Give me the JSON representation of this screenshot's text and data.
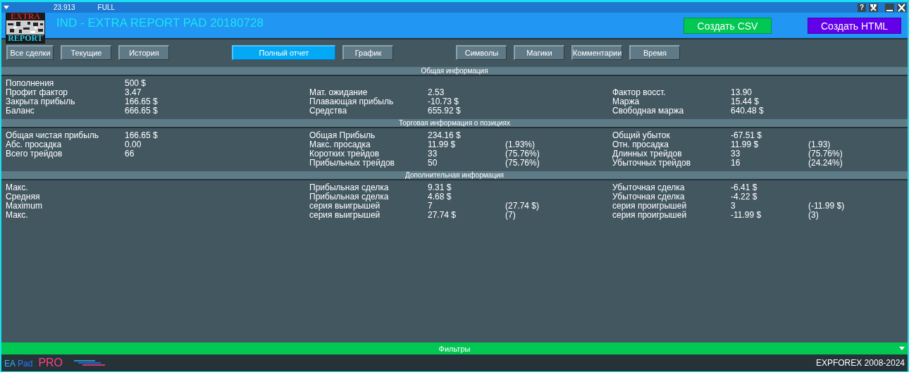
{
  "top_bar": {
    "version": "23.913",
    "mode": "FULL",
    "help": "?"
  },
  "header": {
    "logo": {
      "top": "EXTRA",
      "bottom": "REPORT"
    },
    "title": "IND - EXTRA REPORT PAD 20180728",
    "buttons": [
      {
        "label": "Создать CSV",
        "color": "#00c853"
      },
      {
        "label": "Создать HTML",
        "color": "#6200ea"
      }
    ]
  },
  "tab_groups": [
    [
      {
        "label": "Все сделки",
        "selected": false
      },
      {
        "label": "Текущие",
        "selected": false
      },
      {
        "label": "История",
        "selected": false
      }
    ],
    [
      {
        "label": "Полный отчет",
        "selected": true
      },
      {
        "label": "График",
        "selected": false
      }
    ],
    [
      {
        "label": "Символы",
        "selected": false
      },
      {
        "label": "Магики",
        "selected": false
      },
      {
        "label": "Комментарии",
        "selected": false
      },
      {
        "label": "Время",
        "selected": false
      }
    ]
  ],
  "sections": [
    {
      "title": "Общая информация",
      "rows": [
        {
          "left": {
            "label": "Пополнения",
            "value": "500 $"
          }
        },
        {
          "left": {
            "label": "Профит фактор",
            "value": "3.47"
          },
          "middle": {
            "label": "Мат. ожидание",
            "value": "2.53"
          },
          "right": {
            "label": "Фактор восст.",
            "value": "13.90"
          }
        },
        {
          "left": {
            "label": "Закрыта прибыль",
            "value": "166.65 $"
          },
          "middle": {
            "label": "Плавающая прибыль",
            "value": "-10.73 $"
          },
          "right": {
            "label": "Маржа",
            "value": "15.44 $"
          }
        },
        {
          "left": {
            "label": "Баланс",
            "value": "666.65 $"
          },
          "middle": {
            "label": "Средства",
            "value": "655.92 $"
          },
          "right": {
            "label": "Свободная маржа",
            "value": "640.48 $"
          }
        }
      ]
    },
    {
      "title": "Торговая информация о позициях",
      "rows": [
        {
          "left": {
            "label": "Общая чистая прибыль",
            "value": "166.65 $"
          },
          "middle": {
            "label": "Общая Прибыль",
            "value": "234.16 $"
          },
          "right": {
            "label": "Общий убыток",
            "value": "-67.51 $"
          }
        },
        {
          "left": {
            "label": "Абс. просадка",
            "value": "0.00"
          },
          "middle": {
            "label": "Макс. просадка",
            "value": "11.99 $",
            "note": "(1.93%)"
          },
          "right": {
            "label": "Отн. просадка",
            "value": "11.99 $",
            "note": "(1.93)"
          }
        },
        {
          "left": {
            "label": "Всего трейдов",
            "value": "66"
          },
          "middle": {
            "label": "Коротких трейдов",
            "value": "33",
            "note": "(75.76%)"
          },
          "right": {
            "label": "Длинных трейдов",
            "value": "33",
            "note": "(75.76%)"
          }
        },
        {
          "middle": {
            "label": "Прибыльных трейдов",
            "value": "50",
            "note": "(75.76%)"
          },
          "right": {
            "label": "Убыточных трейдов",
            "value": "16",
            "note": "(24.24%)"
          }
        }
      ]
    },
    {
      "title": "Дополнительная информация",
      "rows": [
        {
          "left": {
            "label": "Макс."
          },
          "middle": {
            "label": "Прибыльная сделка",
            "value": "9.31 $"
          },
          "right": {
            "label": "Убыточная сделка",
            "value": "-6.41 $"
          }
        },
        {
          "left": {
            "label": "Средняя"
          },
          "middle": {
            "label": "Прибыльная сделка",
            "value": "4.68 $"
          },
          "right": {
            "label": "Убыточная сделка",
            "value": "-4.22 $"
          }
        },
        {
          "left": {
            "label": "Maximum"
          },
          "middle": {
            "label": "серия выигрышей",
            "value": "7",
            "note": "(27.74 $)"
          },
          "right": {
            "label": "серия проигрышей",
            "value": "3",
            "note": "(-11.99 $)"
          }
        },
        {
          "left": {
            "label": "Макс."
          },
          "middle": {
            "label": "серия выигрышей",
            "value": "27.74 $",
            "note": "(7)"
          },
          "right": {
            "label": "серия проигрышей",
            "value": "-11.99 $",
            "note": "(3)"
          }
        }
      ]
    }
  ],
  "filter_bar": {
    "label": "Фильтры"
  },
  "footer": {
    "brand": [
      {
        "text": "EA",
        "color": "#29b6f6"
      },
      {
        "text": "Pad",
        "color": "#2979ff"
      },
      {
        "text": "PRO",
        "color": "#ff4081"
      }
    ],
    "copyright": "EXPFOREX 2008-2024"
  }
}
